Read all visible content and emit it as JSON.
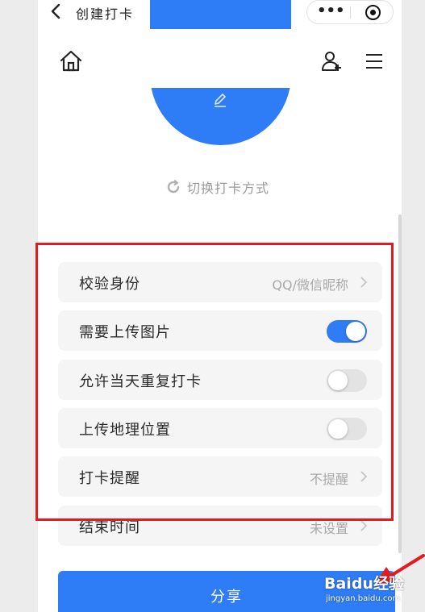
{
  "titlebar": {
    "title": "创建打卡"
  },
  "capsule": {
    "more_label": "•••"
  },
  "header": {
    "home_icon": "home-icon",
    "add_user_icon": "add-user-icon",
    "menu_icon": "hamburger-menu-icon"
  },
  "avatar_area": {
    "edit_icon": "pencil-icon",
    "switch_mode_label": "切换打卡方式"
  },
  "settings": {
    "verify_identity": {
      "label": "校验身份",
      "value": "QQ/微信昵称"
    },
    "upload_photo": {
      "label": "需要上传图片",
      "enabled": true
    },
    "allow_repeat": {
      "label": "允许当天重复打卡",
      "enabled": false
    },
    "upload_location": {
      "label": "上传地理位置",
      "enabled": false
    },
    "reminder": {
      "label": "打卡提醒",
      "value": "不提醒"
    },
    "end_time": {
      "label": "结束时间",
      "value": "未设置"
    }
  },
  "share_button": {
    "label": "分享"
  },
  "watermark": {
    "logo": "Baidu经验",
    "url": "jingyan.baidu.com"
  },
  "colors": {
    "accent": "#2f7cf7",
    "annotation_red": "#e41a22"
  }
}
